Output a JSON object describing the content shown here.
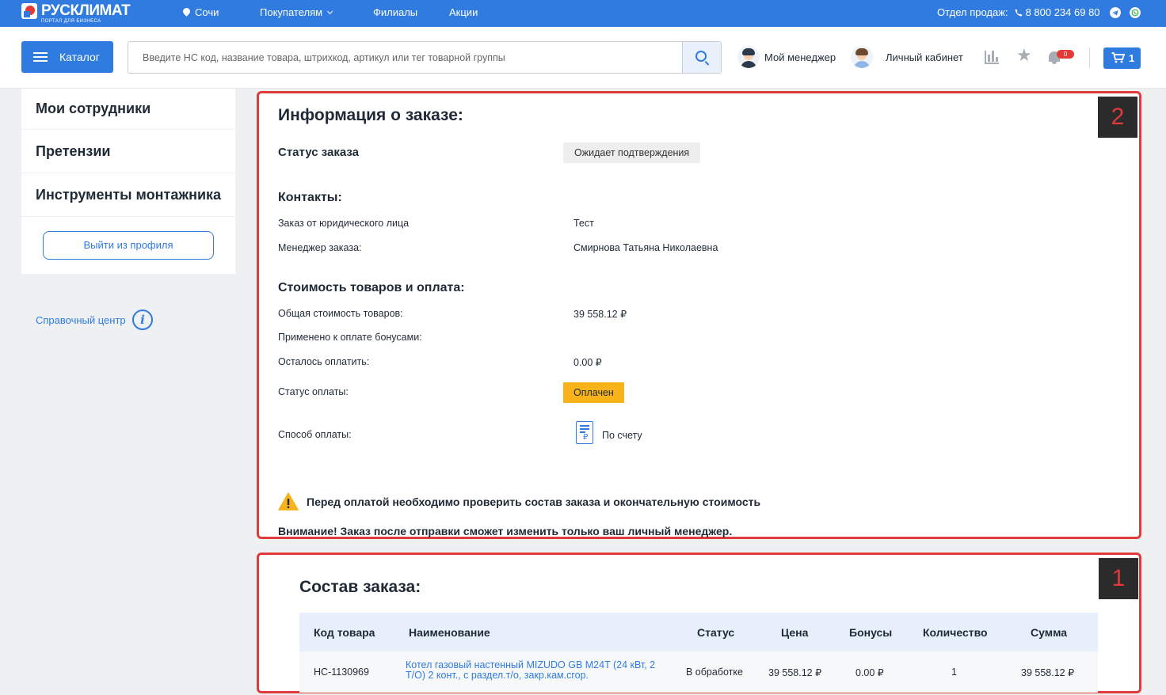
{
  "topbar": {
    "logo_name": "РУСКЛИМАТ",
    "logo_sub": "ПОРТАЛ ДЛЯ БИЗНЕСА",
    "city": "Сочи",
    "nav": [
      "Покупателям",
      "Филиалы",
      "Акции"
    ],
    "sales_label": "Отдел продаж:",
    "phone": "8 800 234 69 80"
  },
  "header": {
    "catalog_label": "Каталог",
    "search_placeholder": "Введите НС код, название товара, штрихкод, артикул или тег товарной группы",
    "manager_label": "Мой менеджер",
    "account_label": "Личный кабинет",
    "notifications_count": "0",
    "cart_count": "1"
  },
  "sidebar": {
    "items": [
      "Мои сотрудники",
      "Претензии",
      "Инструменты монтажника"
    ],
    "logout_label": "Выйти из профиля",
    "help_label": "Справочный центр"
  },
  "order_info": {
    "mark": "2",
    "title": "Информация о заказе:",
    "status_label": "Статус заказа",
    "status_value": "Ожидает подтверждения",
    "contacts_title": "Контакты:",
    "legal_entity_label": "Заказ от юридического лица",
    "legal_entity_value": "Тест",
    "manager_label": "Менеджер заказа:",
    "manager_value": "Смирнова Татьяна Николаевна",
    "cost_title": "Стоимость товаров и оплата:",
    "total_label": "Общая стоимость товаров:",
    "total_value": "39 558.12 ₽",
    "bonus_label": "Применено к оплате бонусами:",
    "remaining_label": "Осталось оплатить:",
    "remaining_value": "0.00 ₽",
    "payment_status_label": "Статус оплаты:",
    "payment_status_value": "Оплачен",
    "payment_method_label": "Способ оплаты:",
    "payment_method_value": "По счету",
    "warning_text": "Перед оплатой необходимо проверить состав заказа и окончательную стоимость",
    "notice_text": "Внимание! Заказ после отправки сможет изменить только ваш личный менеджер."
  },
  "order_items": {
    "mark": "1",
    "title": "Состав заказа:",
    "columns": [
      "Код товара",
      "Наименование",
      "Статус",
      "Цена",
      "Бонусы",
      "Количество",
      "Сумма"
    ],
    "rows": [
      {
        "code": "НС-1130969",
        "name_line1": "Котел газовый настенный MIZUDO GB M24T (24 кВт, 2",
        "name_line2": "Т/О) 2 конт., с раздел.т/о, закр.кам.сгор.",
        "status": "В обработке",
        "price": "39 558.12 ₽",
        "bonus": "0.00 ₽",
        "qty": "1",
        "sum": "39 558.12 ₽"
      }
    ]
  },
  "colors": {
    "brand_blue": "#2f7be0",
    "highlight_red": "#e03a3a",
    "paid_yellow": "#f8b31a"
  }
}
